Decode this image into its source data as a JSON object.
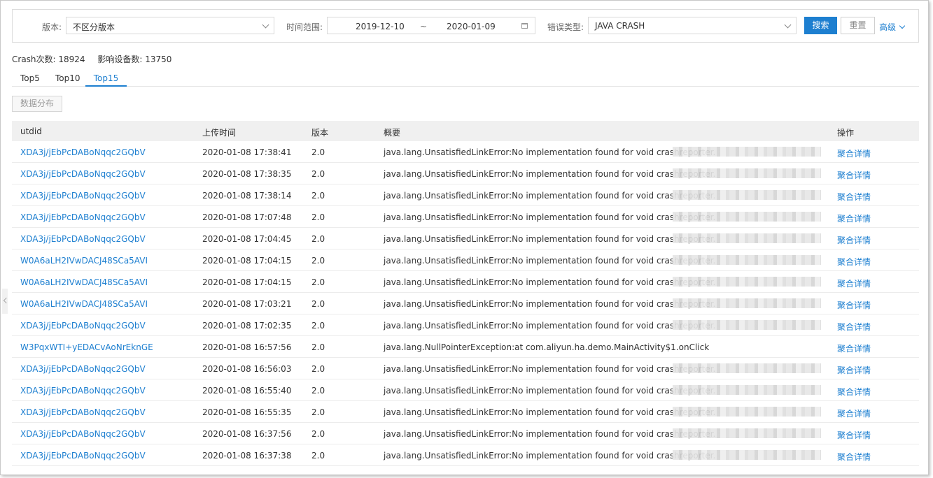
{
  "filters": {
    "version_label": "版本:",
    "version_value": "不区分版本",
    "time_label": "时间范围:",
    "date_start": "2019-12-10",
    "date_sep": "~",
    "date_end": "2020-01-09",
    "error_type_label": "错误类型:",
    "error_type_value": "JAVA CRASH",
    "search_label": "搜索",
    "reset_label": "重置",
    "advanced_label": "高级"
  },
  "stats": {
    "crash_count": "Crash次数: 18924",
    "affected_devices": "影响设备数: 13750"
  },
  "tabs": [
    {
      "label": "Top5"
    },
    {
      "label": "Top10"
    },
    {
      "label": "Top15",
      "active": true
    }
  ],
  "dist_button_label": "数据分布",
  "table": {
    "headers": {
      "utdid": "utdid",
      "time": "上传时间",
      "version": "版本",
      "summary": "概要",
      "op": "操作"
    },
    "rows": [
      {
        "utdid": "XDA3j/jEbPcDABoNqqc2GQbV",
        "time": "2020-01-08 17:38:41",
        "version": "2.0",
        "summary": "java.lang.UnsatisfiedLinkError:No implementation found for void crashreporter.",
        "op": "聚合详情",
        "blurred": true
      },
      {
        "utdid": "XDA3j/jEbPcDABoNqqc2GQbV",
        "time": "2020-01-08 17:38:35",
        "version": "2.0",
        "summary": "java.lang.UnsatisfiedLinkError:No implementation found for void crashreporter.",
        "op": "聚合详情",
        "blurred": true
      },
      {
        "utdid": "XDA3j/jEbPcDABoNqqc2GQbV",
        "time": "2020-01-08 17:38:14",
        "version": "2.0",
        "summary": "java.lang.UnsatisfiedLinkError:No implementation found for void crashreporter.",
        "op": "聚合详情",
        "blurred": true
      },
      {
        "utdid": "XDA3j/jEbPcDABoNqqc2GQbV",
        "time": "2020-01-08 17:07:48",
        "version": "2.0",
        "summary": "java.lang.UnsatisfiedLinkError:No implementation found for void crashreporter.",
        "op": "聚合详情",
        "blurred": true
      },
      {
        "utdid": "XDA3j/jEbPcDABoNqqc2GQbV",
        "time": "2020-01-08 17:04:45",
        "version": "2.0",
        "summary": "java.lang.UnsatisfiedLinkError:No implementation found for void crashreporter.",
        "op": "聚合详情",
        "blurred": true
      },
      {
        "utdid": "W0A6aLH2IVwDACJ48SCa5AVI",
        "time": "2020-01-08 17:04:15",
        "version": "2.0",
        "summary": "java.lang.UnsatisfiedLinkError:No implementation found for void crashreporter.",
        "op": "聚合详情",
        "blurred": true
      },
      {
        "utdid": "W0A6aLH2IVwDACJ48SCa5AVI",
        "time": "2020-01-08 17:04:15",
        "version": "2.0",
        "summary": "java.lang.UnsatisfiedLinkError:No implementation found for void crashreporter.",
        "op": "聚合详情",
        "blurred": true
      },
      {
        "utdid": "W0A6aLH2IVwDACJ48SCa5AVI",
        "time": "2020-01-08 17:03:21",
        "version": "2.0",
        "summary": "java.lang.UnsatisfiedLinkError:No implementation found for void crashreporter.",
        "op": "聚合详情",
        "blurred": true
      },
      {
        "utdid": "XDA3j/jEbPcDABoNqqc2GQbV",
        "time": "2020-01-08 17:02:35",
        "version": "2.0",
        "summary": "java.lang.UnsatisfiedLinkError:No implementation found for void crashreporter.",
        "op": "聚合详情",
        "blurred": true
      },
      {
        "utdid": "W3PqxWTI+yEDACvAoNrEknGE",
        "time": "2020-01-08 16:57:56",
        "version": "2.0",
        "summary": "java.lang.NullPointerException:at com.aliyun.ha.demo.MainActivity$1.onClick",
        "op": "聚合详情",
        "blurred": false
      },
      {
        "utdid": "XDA3j/jEbPcDABoNqqc2GQbV",
        "time": "2020-01-08 16:56:03",
        "version": "2.0",
        "summary": "java.lang.UnsatisfiedLinkError:No implementation found for void crashreporter.",
        "op": "聚合详情",
        "blurred": true
      },
      {
        "utdid": "XDA3j/jEbPcDABoNqqc2GQbV",
        "time": "2020-01-08 16:55:40",
        "version": "2.0",
        "summary": "java.lang.UnsatisfiedLinkError:No implementation found for void crashreporter.",
        "op": "聚合详情",
        "blurred": true
      },
      {
        "utdid": "XDA3j/jEbPcDABoNqqc2GQbV",
        "time": "2020-01-08 16:55:35",
        "version": "2.0",
        "summary": "java.lang.UnsatisfiedLinkError:No implementation found for void crashreporter.",
        "op": "聚合详情",
        "blurred": true
      },
      {
        "utdid": "XDA3j/jEbPcDABoNqqc2GQbV",
        "time": "2020-01-08 16:37:56",
        "version": "2.0",
        "summary": "java.lang.UnsatisfiedLinkError:No implementation found for void crashreporter.",
        "op": "聚合详情",
        "blurred": true
      },
      {
        "utdid": "XDA3j/jEbPcDABoNqqc2GQbV",
        "time": "2020-01-08 16:37:38",
        "version": "2.0",
        "summary": "java.lang.UnsatisfiedLinkError:No implementation found for void crashreporter.",
        "op": "聚合详情",
        "blurred": true
      }
    ]
  },
  "colors": {
    "accent": "#1d7fd0",
    "header_bg": "#f0f0f0"
  }
}
